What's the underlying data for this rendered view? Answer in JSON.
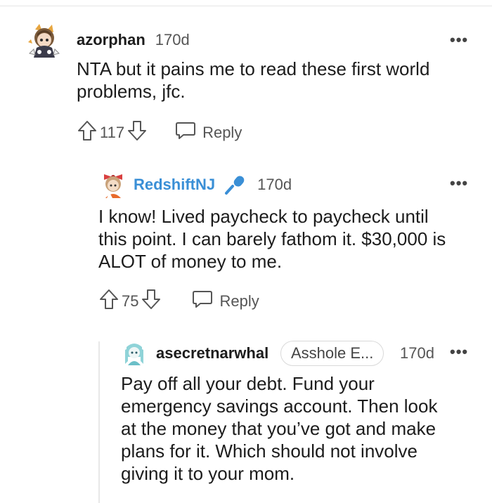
{
  "comments": [
    {
      "username": "azorphan",
      "age": "170d",
      "text_lines": [
        "NTA but it pains me to read these first world",
        "problems, jfc."
      ],
      "votes": "117",
      "reply_label": "Reply",
      "avatar_icon": "anime-character-avatar-icon"
    },
    {
      "username": "RedshiftNJ",
      "age": "170d",
      "user_badge_icon": "microphone-icon",
      "username_color": "#3a8fd6",
      "text_lines": [
        "I know! Lived paycheck to paycheck until",
        "this point. I can barely fathom it. $30,000 is",
        "ALOT of money to me."
      ],
      "votes": "75",
      "reply_label": "Reply",
      "avatar_icon": "bow-girl-avatar-icon"
    },
    {
      "username": "asecretnarwhal",
      "age": "170d",
      "flair": "Asshole E...",
      "text_lines": [
        "Pay off all your debt. Fund your",
        "emergency savings account. Then look",
        "at the money that you’ve got and make",
        "plans for it. Which should not involve",
        "giving it to your mom."
      ],
      "avatar_icon": "narwhal-avatar-icon"
    }
  ],
  "more_label": "•••"
}
